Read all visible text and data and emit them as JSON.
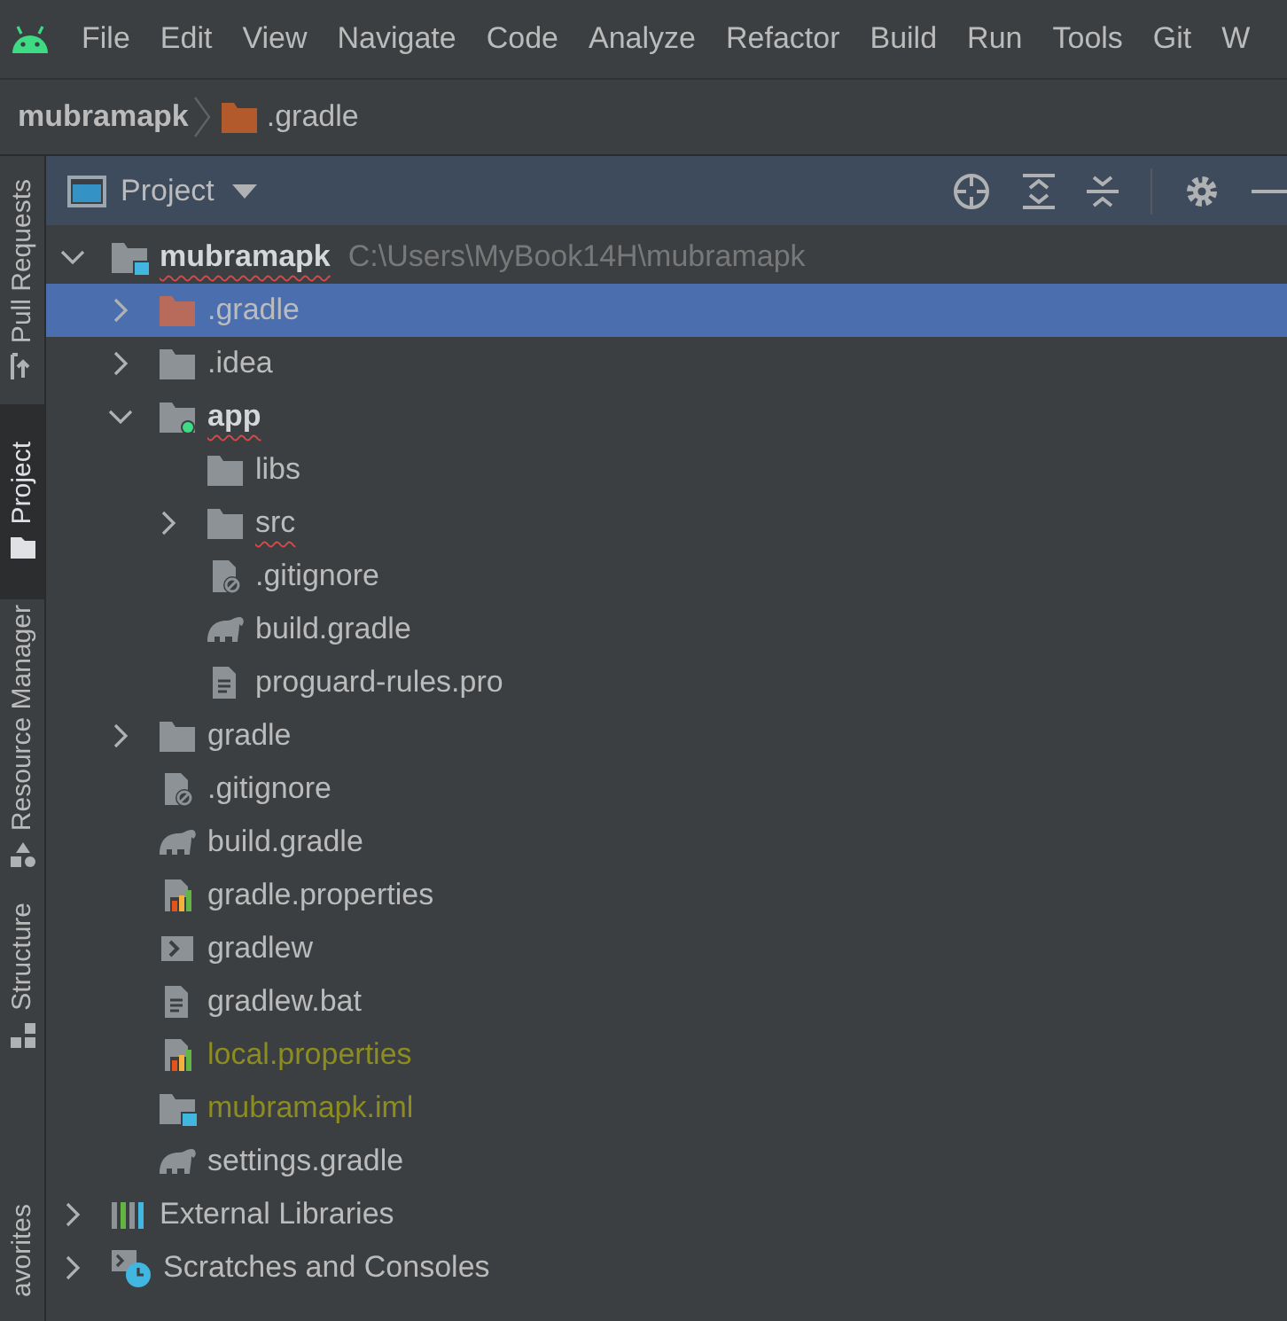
{
  "menu_bar": {
    "items": [
      "File",
      "Edit",
      "View",
      "Navigate",
      "Code",
      "Analyze",
      "Refactor",
      "Build",
      "Run",
      "Tools",
      "Git",
      "W"
    ]
  },
  "breadcrumb": [
    {
      "label": "mubramapk",
      "kind": "project"
    },
    {
      "label": ".gradle",
      "kind": "excluded_folder"
    }
  ],
  "side_tabs": [
    {
      "label": "Pull Requests",
      "kind": "pull_requests",
      "selected": false
    },
    {
      "label": "Project",
      "kind": "project",
      "selected": true
    },
    {
      "label": "Resource Manager",
      "kind": "resources",
      "selected": false
    },
    {
      "label": "Structure",
      "kind": "structure",
      "selected": false
    },
    {
      "label": "avorites",
      "kind": "favorites",
      "selected": false
    }
  ],
  "project_panel": {
    "title": "Project",
    "tree": [
      {
        "label": "mubramapk",
        "kind": "project_root",
        "path": "C:\\Users\\MyBook14H\\mubramapk",
        "expanded": true,
        "selected": false,
        "spelling_error": true,
        "untracked": false,
        "children": [
          {
            "label": ".gradle",
            "kind": "excluded_folder",
            "expanded": false,
            "selected": true,
            "spelling_error": false,
            "untracked": false
          },
          {
            "label": ".idea",
            "kind": "folder",
            "expanded": false,
            "selected": false,
            "spelling_error": false,
            "untracked": false
          },
          {
            "label": "app",
            "kind": "module",
            "expanded": true,
            "selected": false,
            "spelling_error": true,
            "untracked": false,
            "children": [
              {
                "label": "libs",
                "kind": "folder",
                "selected": false,
                "spelling_error": false,
                "untracked": false
              },
              {
                "label": "src",
                "kind": "folder",
                "expanded": false,
                "selected": false,
                "spelling_error": true,
                "untracked": false
              },
              {
                "label": ".gitignore",
                "kind": "ignore_file",
                "selected": false,
                "spelling_error": false,
                "untracked": false
              },
              {
                "label": "build.gradle",
                "kind": "gradle",
                "selected": false,
                "spelling_error": false,
                "untracked": false
              },
              {
                "label": "proguard-rules.pro",
                "kind": "text_file",
                "selected": false,
                "spelling_error": false,
                "untracked": false
              }
            ]
          },
          {
            "label": "gradle",
            "kind": "folder",
            "expanded": false,
            "selected": false,
            "spelling_error": false,
            "untracked": false
          },
          {
            "label": ".gitignore",
            "kind": "ignore_file",
            "selected": false,
            "spelling_error": false,
            "untracked": false
          },
          {
            "label": "build.gradle",
            "kind": "gradle",
            "selected": false,
            "spelling_error": false,
            "untracked": false
          },
          {
            "label": "gradle.properties",
            "kind": "properties",
            "selected": false,
            "spelling_error": false,
            "untracked": false
          },
          {
            "label": "gradlew",
            "kind": "shell",
            "selected": false,
            "spelling_error": false,
            "untracked": false
          },
          {
            "label": "gradlew.bat",
            "kind": "text_file",
            "selected": false,
            "spelling_error": false,
            "untracked": false
          },
          {
            "label": "local.properties",
            "kind": "properties",
            "selected": false,
            "spelling_error": false,
            "untracked": true
          },
          {
            "label": "mubramapk.iml",
            "kind": "iml",
            "selected": false,
            "spelling_error": false,
            "untracked": true
          },
          {
            "label": "settings.gradle",
            "kind": "gradle",
            "selected": false,
            "spelling_error": false,
            "untracked": false
          }
        ]
      },
      {
        "label": "External Libraries",
        "kind": "libraries",
        "expanded": false,
        "selected": false,
        "spelling_error": false,
        "untracked": false
      },
      {
        "label": "Scratches and Consoles",
        "kind": "scratches",
        "expanded": false,
        "selected": false,
        "spelling_error": false,
        "untracked": false
      }
    ]
  }
}
